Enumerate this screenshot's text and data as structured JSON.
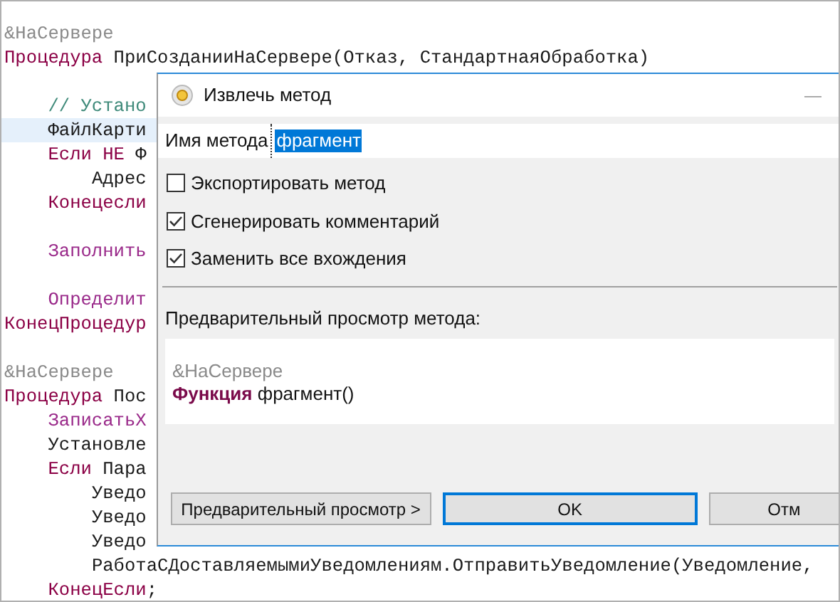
{
  "code_lines": [
    {
      "segments": [
        {
          "kind": "directive",
          "text": "&НаСервере"
        }
      ],
      "current": false
    },
    {
      "segments": [
        {
          "kind": "keyword",
          "text": "Процедура"
        },
        {
          "kind": "plain",
          "text": " ПриСозданииНаСервере(Отказ, СтандартнаяОбработка)"
        }
      ],
      "space_before": false,
      "current": false,
      "children": [
        {
          "segments": [
            {
              "kind": "comment",
              "text": "// Устано"
            }
          ],
          "space_before": true,
          "current": false
        },
        {
          "segments": [
            {
              "kind": "plain",
              "text": "ФайлКарти"
            }
          ],
          "space_before": false,
          "current": true
        },
        {
          "segments": [
            {
              "kind": "keyword",
              "text": "Если НЕ"
            },
            {
              "kind": "plain",
              "text": " Ф"
            }
          ],
          "space_before": false,
          "current": false,
          "children": [
            {
              "segments": [
                {
                  "kind": "plain",
                  "text": "Адрес"
                }
              ],
              "space_before": false,
              "current": false
            }
          ]
        },
        {
          "segments": [
            {
              "kind": "keyword",
              "text": "Конецесли"
            }
          ],
          "space_before": false,
          "current": false
        },
        {
          "segments": [
            {
              "kind": "call",
              "text": "Заполнить"
            }
          ],
          "space_before": true,
          "current": false
        },
        {
          "segments": [
            {
              "kind": "call",
              "text": "Определит"
            }
          ],
          "space_before": true,
          "current": false
        }
      ]
    },
    {
      "segments": [
        {
          "kind": "keyword",
          "text": "КонецПроцедур"
        }
      ],
      "space_before": false,
      "current": false
    },
    {
      "segments": [
        {
          "kind": "directive",
          "text": "&НаСервере"
        }
      ],
      "space_before": true,
      "current": false
    },
    {
      "segments": [
        {
          "kind": "keyword",
          "text": "Процедура"
        },
        {
          "kind": "plain",
          "text": " Пос"
        }
      ],
      "space_before": false,
      "current": false,
      "children": [
        {
          "segments": [
            {
              "kind": "call",
              "text": "ЗаписатьХ"
            }
          ],
          "space_before": false,
          "current": false
        },
        {
          "segments": [
            {
              "kind": "plain",
              "text": "Установле"
            }
          ],
          "space_before": false,
          "current": false
        },
        {
          "segments": [
            {
              "kind": "keyword",
              "text": "Если"
            },
            {
              "kind": "plain",
              "text": " Пара"
            }
          ],
          "space_before": false,
          "current": false,
          "children": [
            {
              "segments": [
                {
                  "kind": "plain",
                  "text": "Уведо"
                }
              ],
              "space_before": false,
              "current": false
            },
            {
              "segments": [
                {
                  "kind": "plain",
                  "text": "Уведо"
                }
              ],
              "space_before": false,
              "current": false
            },
            {
              "segments": [
                {
                  "kind": "plain",
                  "text": "Уведо"
                }
              ],
              "space_before": false,
              "current": false
            },
            {
              "segments": [
                {
                  "kind": "plain",
                  "text": "РаботаСДоставляемымиУведомлениям.ОтправитьУведомление(Уведомление,"
                }
              ],
              "space_before": false,
              "current": false
            }
          ]
        },
        {
          "segments": [
            {
              "kind": "keyword",
              "text": "КонецЕсли"
            },
            {
              "kind": "plain",
              "text": ";"
            }
          ],
          "space_before": false,
          "current": false
        }
      ]
    }
  ],
  "dialog": {
    "title": "Извлечь метод",
    "minimize": "—",
    "name_label": "Имя метода",
    "name_value": "фрагмент",
    "options": [
      {
        "label": "Экспортировать метод",
        "checked": false
      },
      {
        "label": "Сгенерировать комментарий",
        "checked": true
      },
      {
        "label": "Заменить все вхождения",
        "checked": true
      }
    ],
    "preview_label": "Предварительный просмотр метода:",
    "preview_lines": [
      "&НаСервере",
      "**Функция** фрагмент()"
    ],
    "buttons": [
      {
        "label": "Предварительный просмотр >",
        "focused": false
      },
      {
        "label": "OK",
        "focused": true
      },
      {
        "label": "Отм",
        "focused": false
      }
    ]
  }
}
